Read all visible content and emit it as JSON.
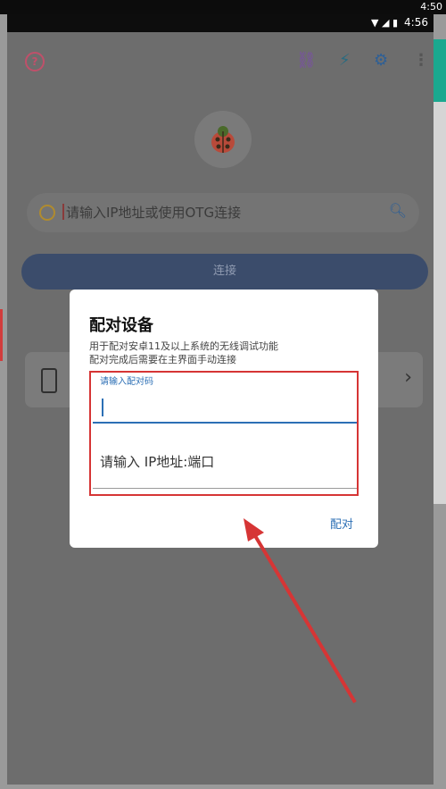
{
  "outer": {
    "time": "4:50"
  },
  "status": {
    "time": "4:56"
  },
  "topbar": {
    "help_icon": "help-circle-icon",
    "link_icon": "link-icon",
    "flash_icon": "lightning-icon",
    "settings_icon": "gear-icon",
    "more_icon": "more-vert-icon"
  },
  "search": {
    "placeholder": "请输入IP地址或使用OTG连接"
  },
  "connect": {
    "label": "连接"
  },
  "dialog": {
    "title": "配对设备",
    "desc_line1": "用于配对安卓11及以上系统的无线调试功能",
    "desc_line2": "配对完成后需要在主界面手动连接",
    "pair_code_label": "请输入配对码",
    "ip_port_placeholder": "请输入 IP地址:端口",
    "pair_button": "配对"
  },
  "colors": {
    "accent": "#2c6fb5",
    "annotation": "#d63535",
    "connect_button": "#3b4c6b"
  }
}
